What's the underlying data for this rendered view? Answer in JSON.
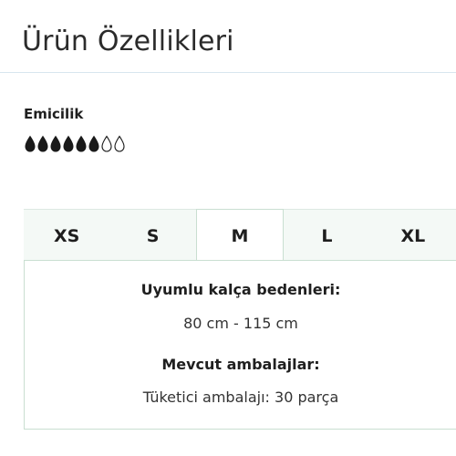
{
  "header": {
    "title": "Ürün Özellikleri"
  },
  "absorbency": {
    "label": "Emicilik",
    "level": 6,
    "max": 8,
    "filled_color": "#1a1a1a",
    "empty_color": "#1a1a1a",
    "icon": "water-drop-icon"
  },
  "sizes": {
    "tabs": [
      {
        "label": "XS",
        "active": false
      },
      {
        "label": "S",
        "active": false
      },
      {
        "label": "M",
        "active": true
      },
      {
        "label": "L",
        "active": false
      },
      {
        "label": "XL",
        "active": false
      }
    ],
    "active_content": {
      "hip_heading": "Uyumlu kalça bedenleri:",
      "hip_value": "80 cm - 115 cm",
      "package_heading": "Mevcut ambalajlar:",
      "package_value": "Tüketici ambalajı: 30 parça"
    }
  },
  "colors": {
    "tab_bar_bg": "#f4f9f6",
    "border": "#c9dfd1",
    "divider": "#d8e6ef"
  }
}
